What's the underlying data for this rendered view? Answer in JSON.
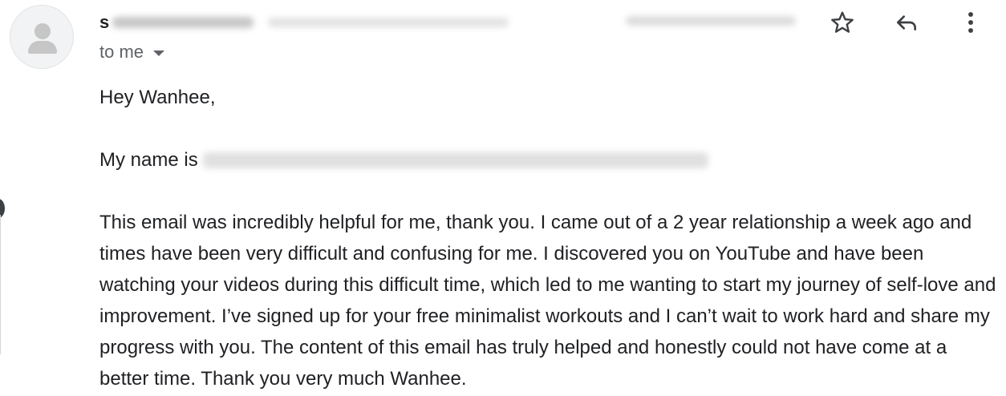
{
  "sender": {
    "initial": "s"
  },
  "recipient": {
    "label": "to me"
  },
  "icons": {
    "star": "star-icon",
    "reply": "reply-icon",
    "more": "more-vert-icon",
    "caret": "caret-down-icon",
    "avatar": "avatar-person-icon"
  },
  "email": {
    "greeting": "Hey Wanhee,",
    "intro_prefix": "My name is",
    "body": "This email was incredibly helpful for me, thank you. I came out of a 2 year relationship a week ago and times have been very difficult and confusing for me. I discovered you on YouTube and have been watching your videos during this difficult time, which led to me wanting to start my journey of self-love and improvement. I’ve signed up for your free minimalist workouts and I can’t wait to work hard and share my progress with you. The content of this email has truly helped and honestly could not have come at a better time. Thank you very much Wanhee."
  },
  "colors": {
    "text": "#202124",
    "secondary_text": "#5f6368",
    "icon": "#3c4043",
    "avatar_bg": "#f1f3f4",
    "avatar_fg": "#c6c6c6"
  }
}
